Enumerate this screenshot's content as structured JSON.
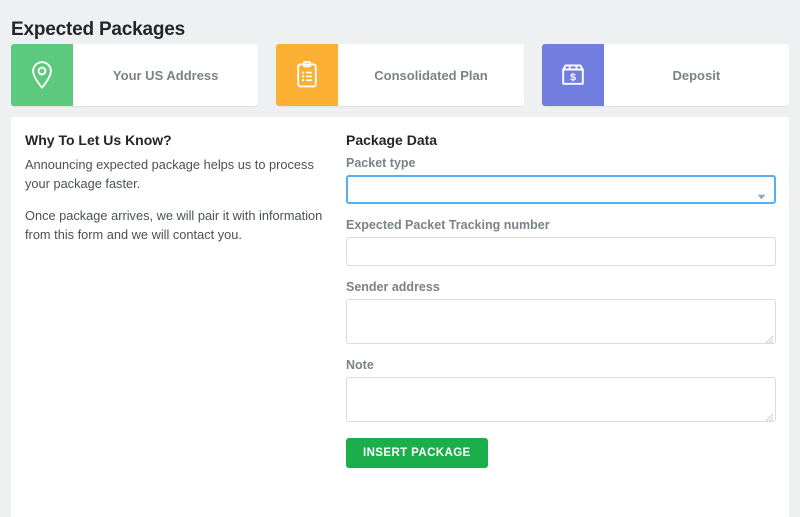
{
  "page": {
    "title": "Expected Packages"
  },
  "nav_tiles": [
    {
      "label": "Your US Address",
      "icon": "map-pin-icon",
      "color": "#5cc97f"
    },
    {
      "label": "Consolidated Plan",
      "icon": "clipboard-list-icon",
      "color": "#fbaf33"
    },
    {
      "label": "Deposit",
      "icon": "box-dollar-icon",
      "color": "#717ee0"
    }
  ],
  "info_panel": {
    "heading": "Why To Let Us Know?",
    "paragraphs": [
      "Announcing expected package helps us to process your package faster.",
      "Once package arrives, we will pair it with information from this form and we will contact you."
    ]
  },
  "form": {
    "heading": "Package Data",
    "fields": {
      "packet_type": {
        "label": "Packet type",
        "value": "",
        "selected_option": "",
        "focused": true,
        "arrow_icon": "chevron-down-icon"
      },
      "tracking_number": {
        "label": "Expected Packet Tracking number",
        "value": "",
        "placeholder": ""
      },
      "sender_address": {
        "label": "Sender address",
        "value": "",
        "placeholder": ""
      },
      "note": {
        "label": "Note",
        "value": "",
        "placeholder": ""
      }
    },
    "submit_label": "INSERT PACKAGE",
    "submit_color": "#1aaf4b"
  }
}
